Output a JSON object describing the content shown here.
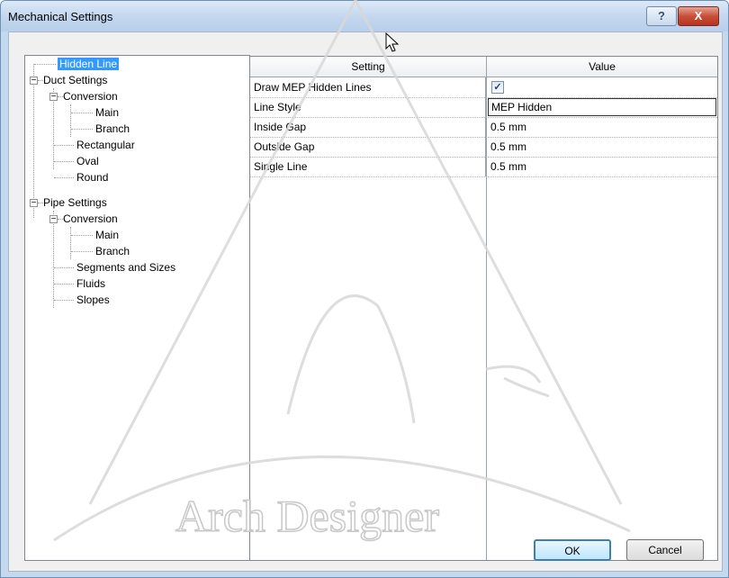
{
  "window": {
    "title": "Mechanical Settings",
    "help_label": "?",
    "close_label": "X"
  },
  "tree": {
    "items": [
      {
        "label": "Hidden Line",
        "selected": true
      },
      {
        "label": "Duct Settings"
      },
      {
        "label": "Conversion"
      },
      {
        "label": "Main"
      },
      {
        "label": "Branch"
      },
      {
        "label": "Rectangular"
      },
      {
        "label": "Oval"
      },
      {
        "label": "Round"
      },
      {
        "label": "Pipe Settings"
      },
      {
        "label": "Conversion"
      },
      {
        "label": "Main"
      },
      {
        "label": "Branch"
      },
      {
        "label": "Segments and Sizes"
      },
      {
        "label": "Fluids"
      },
      {
        "label": "Slopes"
      }
    ],
    "expanded_symbol": "−"
  },
  "grid": {
    "headers": {
      "setting": "Setting",
      "value": "Value"
    },
    "rows": [
      {
        "setting": "Draw MEP Hidden Lines",
        "value": "",
        "checked": true
      },
      {
        "setting": "Line Style",
        "value": "MEP Hidden"
      },
      {
        "setting": "Inside Gap",
        "value": "0.5 mm"
      },
      {
        "setting": "Outside Gap",
        "value": "0.5 mm"
      },
      {
        "setting": "Single Line",
        "value": "0.5 mm"
      }
    ],
    "check_mark": "✓"
  },
  "buttons": {
    "ok": "OK",
    "cancel": "Cancel"
  },
  "watermark": {
    "text": "Arch Designer"
  }
}
